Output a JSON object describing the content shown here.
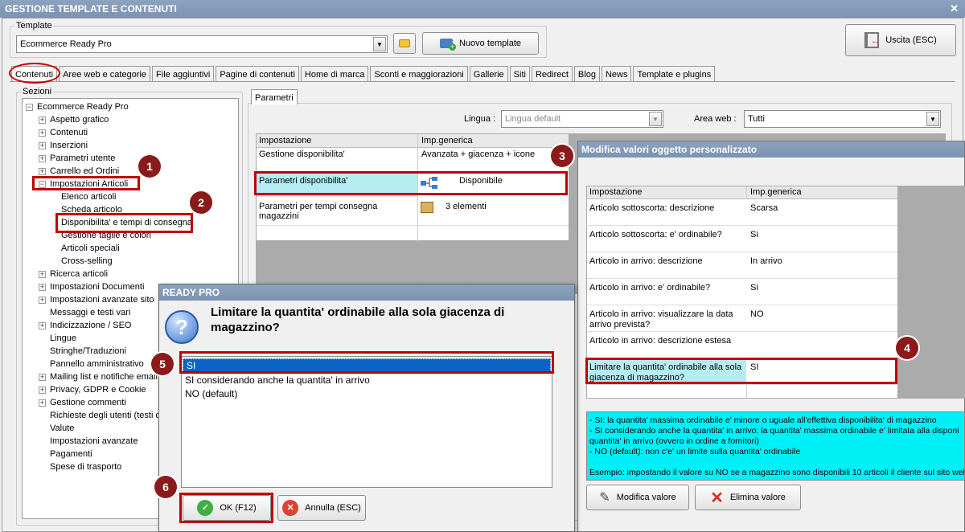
{
  "window": {
    "title": "GESTIONE TEMPLATE E CONTENUTI",
    "close": "✕"
  },
  "template": {
    "group_label": "Template",
    "selected": "Ecommerce Ready Pro",
    "new_button": "Nuovo template",
    "exit_button": "Uscita (ESC)"
  },
  "tabs": [
    "Contenuti",
    "Aree web e categorie",
    "File aggiuntivi",
    "Pagine di contenuti",
    "Home di marca",
    "Sconti e maggiorazioni",
    "Gallerie",
    "Siti",
    "Redirect",
    "Blog",
    "News",
    "Template e plugins"
  ],
  "sections": {
    "label": "Sezioni",
    "root": "Ecommerce Ready Pro",
    "items": [
      {
        "label": "Aspetto grafico",
        "pm": "+"
      },
      {
        "label": "Contenuti",
        "pm": "+"
      },
      {
        "label": "Inserzioni",
        "pm": "+"
      },
      {
        "label": "Parametri utente",
        "pm": "+"
      },
      {
        "label": "Carrello ed Ordini",
        "pm": "+"
      },
      {
        "label": "Impostazioni Articoli",
        "pm": "−"
      },
      {
        "label": "Elenco articoli",
        "pm": "",
        "child": true
      },
      {
        "label": "Scheda articolo",
        "pm": "",
        "child": true
      },
      {
        "label": "Disponibilita' e tempi di consegna",
        "pm": "",
        "child": true
      },
      {
        "label": "Gestione taglie e colori",
        "pm": "",
        "child": true
      },
      {
        "label": "Articoli speciali",
        "pm": "",
        "child": true
      },
      {
        "label": "Cross-selling",
        "pm": "",
        "child": true
      },
      {
        "label": "Ricerca articoli",
        "pm": "+"
      },
      {
        "label": "Impostazioni Documenti",
        "pm": "+"
      },
      {
        "label": "Impostazioni avanzate sito",
        "pm": "+"
      },
      {
        "label": "Messaggi e testi vari",
        "pm": ""
      },
      {
        "label": "Indicizzazione / SEO",
        "pm": "+"
      },
      {
        "label": "Lingue",
        "pm": ""
      },
      {
        "label": "Stringhe/Traduzioni",
        "pm": ""
      },
      {
        "label": "Pannello amministrativo",
        "pm": ""
      },
      {
        "label": "Mailing list e notifiche email",
        "pm": "+"
      },
      {
        "label": "Privacy, GDPR e Cookie",
        "pm": "+"
      },
      {
        "label": "Gestione commenti",
        "pm": "+"
      },
      {
        "label": "Richieste degli utenti (testi d",
        "pm": ""
      },
      {
        "label": "Valute",
        "pm": ""
      },
      {
        "label": "Impostazioni avanzate",
        "pm": ""
      },
      {
        "label": "Pagamenti",
        "pm": ""
      },
      {
        "label": "Spese di trasporto",
        "pm": ""
      }
    ]
  },
  "params": {
    "tab": "Parametri",
    "lingua_label": "Lingua :",
    "lingua_value": "Lingua default",
    "area_label": "Area web :",
    "area_value": "Tutti",
    "col1": "Impostazione",
    "col2": "Imp.generica",
    "rows": [
      {
        "name": "Gestione disponibilita'",
        "value": "Avanzata + giacenza + icone"
      },
      {
        "name": "Parametri disponibilita'",
        "value": "Disponibile"
      },
      {
        "name": "Parametri per tempi consegna magazzini",
        "value": "3 elementi"
      }
    ]
  },
  "custom": {
    "title": "Modifica valori oggetto personalizzato",
    "col1": "Impostazione",
    "col2": "Imp.generica",
    "rows": [
      {
        "name": "Articolo sottoscorta: descrizione",
        "value": "Scarsa"
      },
      {
        "name": "Articolo sottoscorta: e' ordinabile?",
        "value": "Si"
      },
      {
        "name": "Articolo in arrivo: descrizione",
        "value": "In arrivo"
      },
      {
        "name": "Articolo in arrivo: e' ordinabile?",
        "value": "Si"
      },
      {
        "name": "Articolo in arrivo: visualizzare la data arrivo prevista?",
        "value": "NO"
      },
      {
        "name": "Articolo in arrivo: descrizione estesa",
        "value": ""
      },
      {
        "name": "Limitare la quantita' ordinabile alla sola giacenza di magazzino?",
        "value": "SI"
      }
    ],
    "help": [
      "- SI: la quantita' massima ordinabile e' minore o uguale all'effettiva disponibilita' di magazzino",
      "- SI considerando anche la quantita' in arrivo: la quantita' massima ordinabile e' limitata alla disponi",
      "quantita' in arrivo (ovvero in ordine a fornitori)",
      "- NO (default): non c'e' un limite sulla quantita' ordinabile",
      "",
      "Esempio: impostando il valore su NO se a magazzino sono disponibili 10 articoli il cliente sul sito web"
    ],
    "edit_button": "Modifica valore",
    "delete_button": "Elimina valore"
  },
  "dialog": {
    "title": "READY PRO",
    "question": "Limitare la quantita' ordinabile alla sola giacenza di magazzino?",
    "options": [
      "SI",
      "SI considerando anche la quantita' in arrivo",
      "NO (default)"
    ],
    "ok": "OK (F12)",
    "cancel": "Annulla (ESC)"
  },
  "callouts": [
    "1",
    "2",
    "3",
    "4",
    "5",
    "6"
  ],
  "colors": {
    "accent": "#0a64c8",
    "highlight": "#b4eef2",
    "callout": "#8b1a1a",
    "redbox": "#c00000"
  }
}
